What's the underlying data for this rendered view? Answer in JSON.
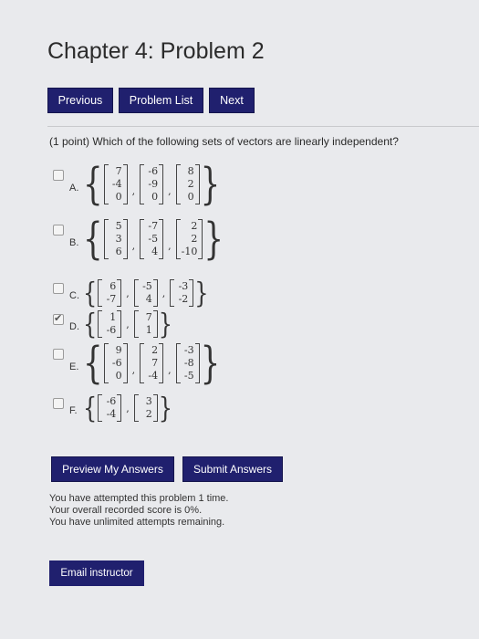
{
  "page": {
    "title": "Chapter 4: Problem 2"
  },
  "nav": {
    "previous": "Previous",
    "problem_list": "Problem List",
    "next": "Next"
  },
  "question": "(1 point) Which of the following sets of vectors are linearly independent?",
  "options": [
    {
      "label": "A.",
      "checked": false,
      "vectors": [
        [
          "7",
          "-4",
          "0"
        ],
        [
          "-6",
          "-9",
          "0"
        ],
        [
          "8",
          "2",
          "0"
        ]
      ]
    },
    {
      "label": "B.",
      "checked": false,
      "vectors": [
        [
          "5",
          "3",
          "6"
        ],
        [
          "-7",
          "-5",
          "4"
        ],
        [
          "2",
          "2",
          "-10"
        ]
      ]
    },
    {
      "label": "C.",
      "checked": false,
      "vectors": [
        [
          "6",
          "-7"
        ],
        [
          "-5",
          "4"
        ],
        [
          "-3",
          "-2"
        ]
      ]
    },
    {
      "label": "D.",
      "checked": true,
      "vectors": [
        [
          "1",
          "-6"
        ],
        [
          "7",
          "1"
        ]
      ]
    },
    {
      "label": "E.",
      "checked": false,
      "vectors": [
        [
          "9",
          "-6",
          "0"
        ],
        [
          "2",
          "7",
          "-4"
        ],
        [
          "-3",
          "-8",
          "-5"
        ]
      ]
    },
    {
      "label": "F.",
      "checked": false,
      "vectors": [
        [
          "-6",
          "-4"
        ],
        [
          "3",
          "2"
        ]
      ]
    }
  ],
  "actions": {
    "preview": "Preview My Answers",
    "submit": "Submit Answers"
  },
  "status": {
    "line1": "You have attempted this problem 1 time.",
    "line2": "Your overall recorded score is 0%.",
    "line3": "You have unlimited attempts remaining."
  },
  "email": "Email instructor",
  "colors": {
    "button_bg": "#20206e",
    "page_bg": "#e9eaed"
  }
}
